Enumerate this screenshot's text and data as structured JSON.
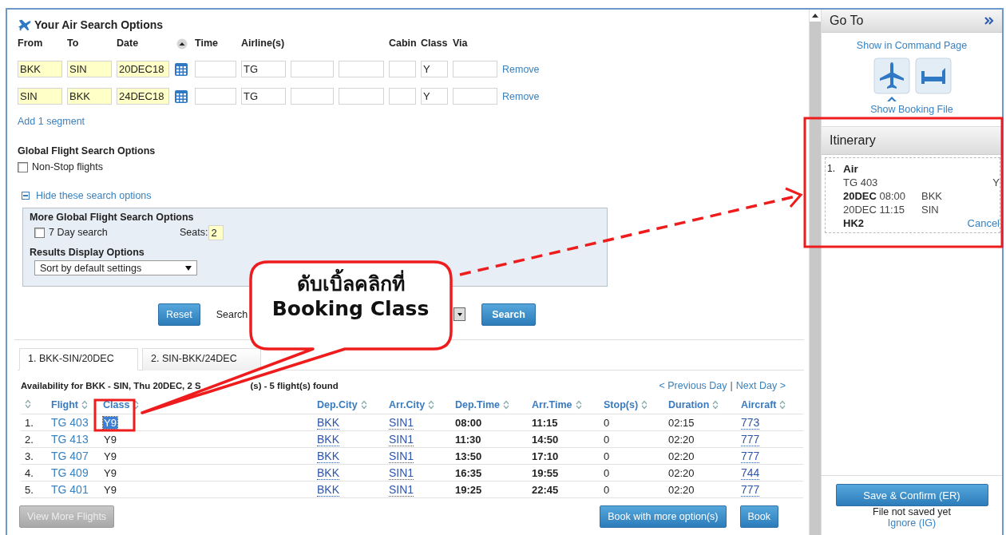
{
  "search": {
    "title": "Your Air Search Options",
    "columns": [
      "From",
      "To",
      "Date",
      "Time",
      "Airline(s)",
      "Cabin",
      "Class",
      "Via"
    ],
    "segments": [
      {
        "from": "BKK",
        "to": "SIN",
        "date": "20DEC18",
        "airline": "TG",
        "class": "Y",
        "remove": "Remove"
      },
      {
        "from": "SIN",
        "to": "BKK",
        "date": "24DEC18",
        "airline": "TG",
        "class": "Y",
        "remove": "Remove"
      }
    ],
    "add_segment": "Add 1 segment",
    "global_title": "Global Flight Search Options",
    "nonstop": {
      "label": "Non-Stop flights",
      "checked": false
    },
    "toggle": "Hide these search options",
    "more": {
      "title": "More Global Flight Search Options",
      "seven_day": {
        "label": "7 Day search",
        "checked": false
      },
      "seats_label": "Seats:",
      "seats": "2",
      "results_title": "Results Display Options",
      "sort": "Sort by default settings"
    },
    "reset": "Reset",
    "search_label": "Search",
    "search_button": "Search"
  },
  "tabs": [
    {
      "label": "1. BKK-SIN/20DEC",
      "selected": true
    },
    {
      "label": "2. SIN-BKK/24DEC",
      "selected": false
    }
  ],
  "availability": {
    "heading": [
      "Availability for BKK - SIN, Thu 20DEC, 2 S",
      "(s) - 5 flight(s) found"
    ],
    "prev_day": "< Previous Day",
    "separator": "|",
    "next_day": "Next Day >",
    "columns": [
      "Flight",
      "Class",
      "Dep.City",
      "Arr.City",
      "Dep.Time",
      "Arr.Time",
      "Stop(s)",
      "Duration",
      "Aircraft"
    ],
    "rows": [
      {
        "number": "1.",
        "flight": "TG 403",
        "class": "Y9",
        "class_selected": true,
        "dep_city": "BKK",
        "arr_city": "SIN1",
        "dep_time": "08:00",
        "arr_time": "11:15",
        "stops": "0",
        "duration": "02:15",
        "aircraft": "773"
      },
      {
        "number": "2.",
        "flight": "TG 413",
        "class": "Y9",
        "class_selected": false,
        "dep_city": "BKK",
        "arr_city": "SIN1",
        "dep_time": "11:30",
        "arr_time": "14:50",
        "stops": "0",
        "duration": "02:20",
        "aircraft": "777"
      },
      {
        "number": "3.",
        "flight": "TG 407",
        "class": "Y9",
        "class_selected": false,
        "dep_city": "BKK",
        "arr_city": "SIN1",
        "dep_time": "13:50",
        "arr_time": "17:10",
        "stops": "0",
        "duration": "02:20",
        "aircraft": "777"
      },
      {
        "number": "4.",
        "flight": "TG 409",
        "class": "Y9",
        "class_selected": false,
        "dep_city": "BKK",
        "arr_city": "SIN1",
        "dep_time": "16:35",
        "arr_time": "19:55",
        "stops": "0",
        "duration": "02:20",
        "aircraft": "744"
      },
      {
        "number": "5.",
        "flight": "TG 401",
        "class": "Y9",
        "class_selected": false,
        "dep_city": "BKK",
        "arr_city": "SIN1",
        "dep_time": "19:25",
        "arr_time": "22:45",
        "stops": "0",
        "duration": "02:20",
        "aircraft": "777"
      }
    ],
    "view_more": {
      "label": "View More Flights",
      "disabled": true
    },
    "book_more": "Book with more option(s)",
    "book": "Book"
  },
  "goto": {
    "title": "Go To",
    "command_link": "Show in Command Page",
    "booking_link": "Show Booking File"
  },
  "itinerary": {
    "title": "Itinerary",
    "segments": [
      {
        "number": "1.",
        "type": "Air",
        "flight": "TG 403",
        "class": "Y",
        "dep_date": "20DEC",
        "dep_time": "08:00",
        "dep_city": "BKK",
        "arrival": "20DEC 11:15",
        "arr_city": "SIN",
        "status": "HK2",
        "cancel": "Cancel"
      }
    ]
  },
  "footer": {
    "save": "Save & Confirm (ER)",
    "status": "File not saved yet",
    "ignore": "Ignore (IG)"
  },
  "callout": {
    "lines": [
      "ดับเบิ้ลคลิกที่",
      "Booking Class"
    ]
  }
}
